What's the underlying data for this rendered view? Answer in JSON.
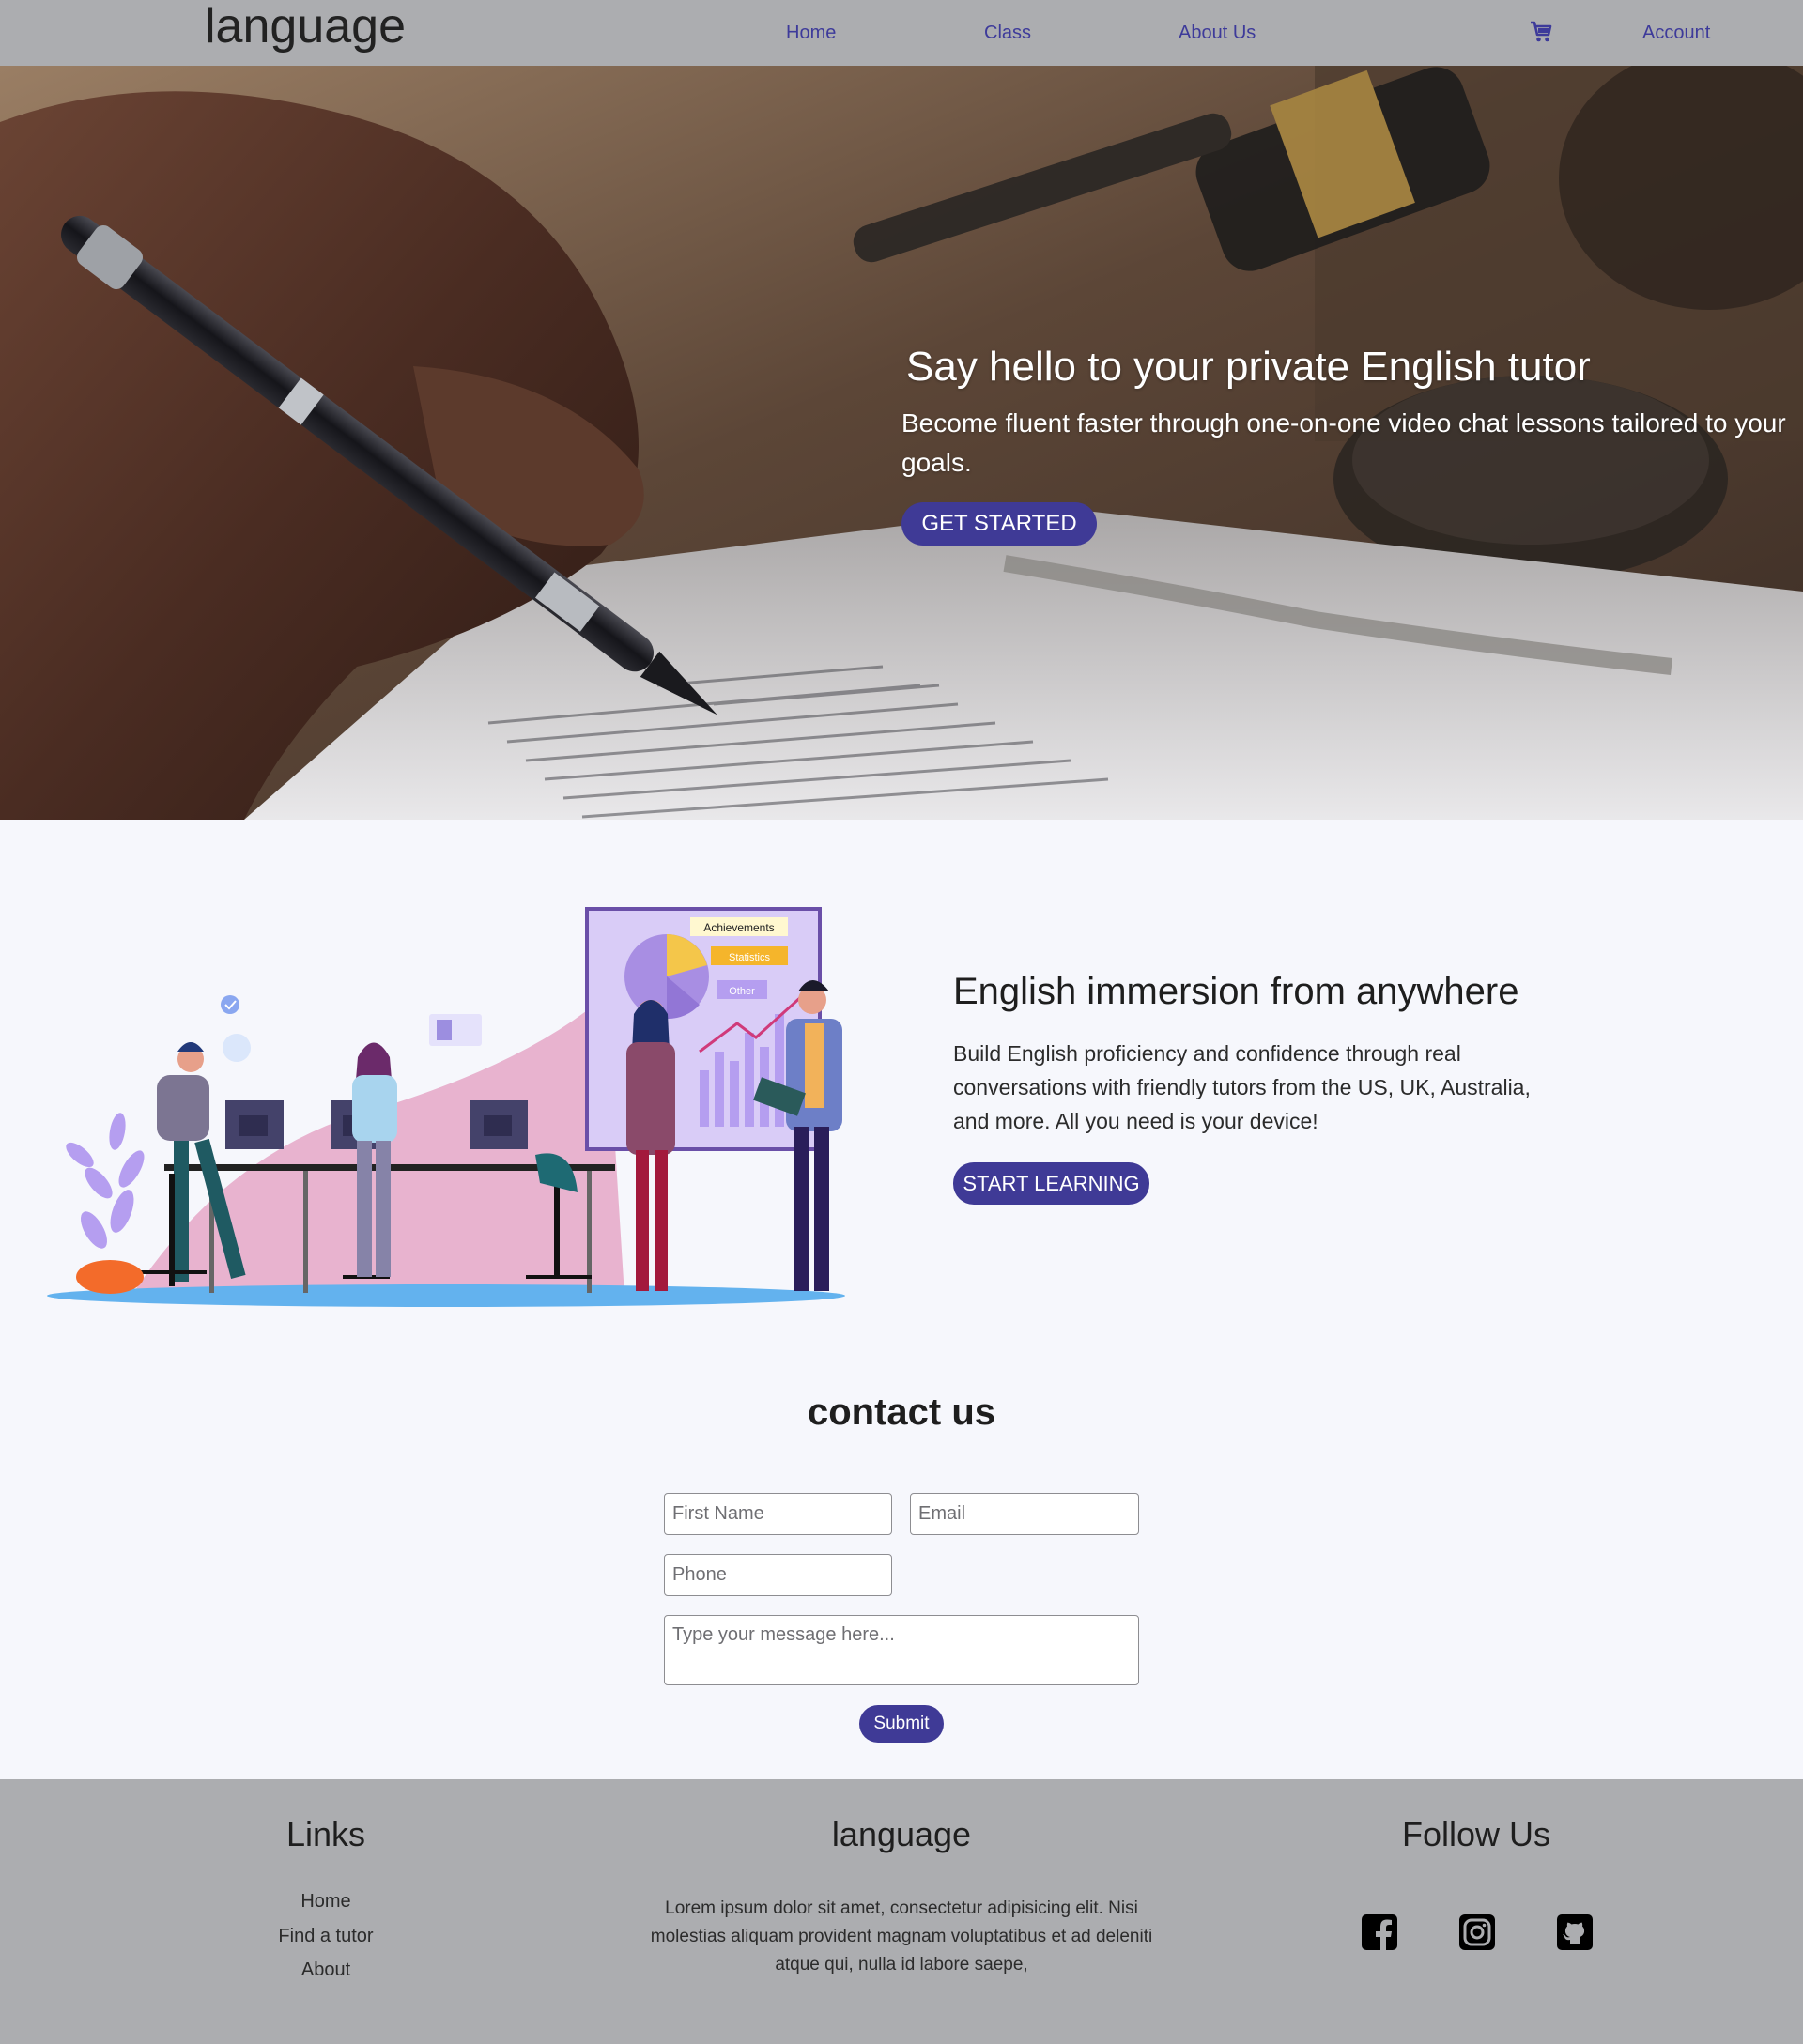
{
  "navbar": {
    "brand": "language",
    "links": [
      {
        "label": "Home"
      },
      {
        "label": "Class"
      },
      {
        "label": "About Us"
      }
    ],
    "cart_icon": "cart-icon",
    "account_label": "Account",
    "link_color": "#3d3a9a",
    "background": "#acadb0"
  },
  "hero": {
    "title": "Say hello to your private English tutor",
    "subtitle": "Become fluent faster through one-on-one video chat lessons tailored to your goals.",
    "button_label": "GET STARTED"
  },
  "immersion": {
    "illustration_labels": [
      "Achievements",
      "Statistics",
      "Other"
    ],
    "title": "English immersion from anywhere",
    "text": "Build English proficiency and confidence through real conversations with friendly tutors from the US, UK, Australia, and more. All you need is your device!",
    "button_label": "START LEARNING"
  },
  "contact": {
    "title": "contact us",
    "first_name_placeholder": "First Name",
    "email_placeholder": "Email",
    "phone_placeholder": "Phone",
    "message_placeholder": "Type your message here...",
    "submit_label": "Submit"
  },
  "footer": {
    "links_heading": "Links",
    "links": [
      "Home",
      "Find a tutor",
      "About"
    ],
    "brand_heading": "language",
    "lorem": "Lorem ipsum dolor sit amet, consectetur adipisicing elit. Nisi molestias aliquam provident magnam voluptatibus et ad deleniti atque qui, nulla id labore saepe,",
    "follow_heading": "Follow Us",
    "social_icons": [
      "facebook-icon",
      "instagram-icon",
      "github-icon"
    ]
  },
  "colors": {
    "accent": "#3f3a96",
    "page_background": "#f6f7fc",
    "footer_background": "#acadb0"
  }
}
